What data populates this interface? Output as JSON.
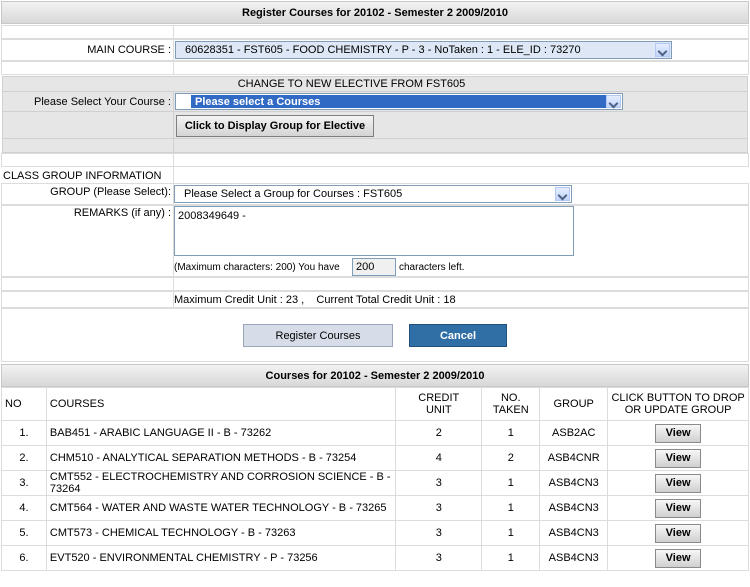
{
  "page_title": "Register Courses for 20102 - Semester 2 2009/2010",
  "main_course": {
    "label": "MAIN COURSE :",
    "value": "60628351 - FST605 - FOOD CHEMISTRY - P - 3 - NoTaken : 1 - ELE_ID : 73270"
  },
  "elective": {
    "title": "CHANGE TO NEW ELECTIVE FROM FST605",
    "label": "Please Select Your Course :",
    "value": "Please select a Courses",
    "button": "Click to Display Group for Elective"
  },
  "class_group": {
    "section_title": "CLASS GROUP INFORMATION",
    "group_label": "GROUP (Please Select):",
    "group_value": "Please Select a Group for Courses : FST605",
    "remarks_label": "REMARKS (if any) :",
    "remarks_value": "2008349649 -",
    "char_prefix": "(Maximum characters: 200) You have",
    "char_count": "200",
    "char_suffix": "characters left.",
    "credit_info": "Maximum Credit Unit : 23 ,    Current Total Credit Unit : 18"
  },
  "actions": {
    "register": "Register Courses",
    "cancel": "Cancel"
  },
  "courses_table": {
    "title": "Courses for 20102 - Semester 2 2009/2010",
    "headers": {
      "no": "NO",
      "courses": "COURSES",
      "credit_unit": "CREDIT UNIT",
      "no_taken": "NO. TAKEN",
      "group": "GROUP",
      "action": "CLICK BUTTON TO DROP OR UPDATE GROUP"
    },
    "rows": [
      {
        "no": "1.",
        "course": "BAB451 - ARABIC LANGUAGE II - B - 73262",
        "credit": "2",
        "taken": "1",
        "group": "ASB2AC",
        "button": "View"
      },
      {
        "no": "2.",
        "course": "CHM510 - ANALYTICAL SEPARATION METHODS - B - 73254",
        "credit": "4",
        "taken": "2",
        "group": "ASB4CNR",
        "button": "View"
      },
      {
        "no": "3.",
        "course": "CMT552 - ELECTROCHEMISTRY AND CORROSION SCIENCE - B - 73264",
        "credit": "3",
        "taken": "1",
        "group": "ASB4CN3",
        "button": "View"
      },
      {
        "no": "4.",
        "course": "CMT564 - WATER AND WASTE WATER TECHNOLOGY - B - 73265",
        "credit": "3",
        "taken": "1",
        "group": "ASB4CN3",
        "button": "View"
      },
      {
        "no": "5.",
        "course": "CMT573 - CHEMICAL TECHNOLOGY - B - 73263",
        "credit": "3",
        "taken": "1",
        "group": "ASB4CN3",
        "button": "View"
      },
      {
        "no": "6.",
        "course": "EVT520 - ENVIRONMENTAL CHEMISTRY - P - 73256",
        "credit": "3",
        "taken": "1",
        "group": "ASB4CN3",
        "button": "View"
      }
    ]
  },
  "colors": {
    "selected_blue": "#316ac5",
    "cancel_blue": "#2f6fa6",
    "register_bg": "#d6dde9"
  }
}
